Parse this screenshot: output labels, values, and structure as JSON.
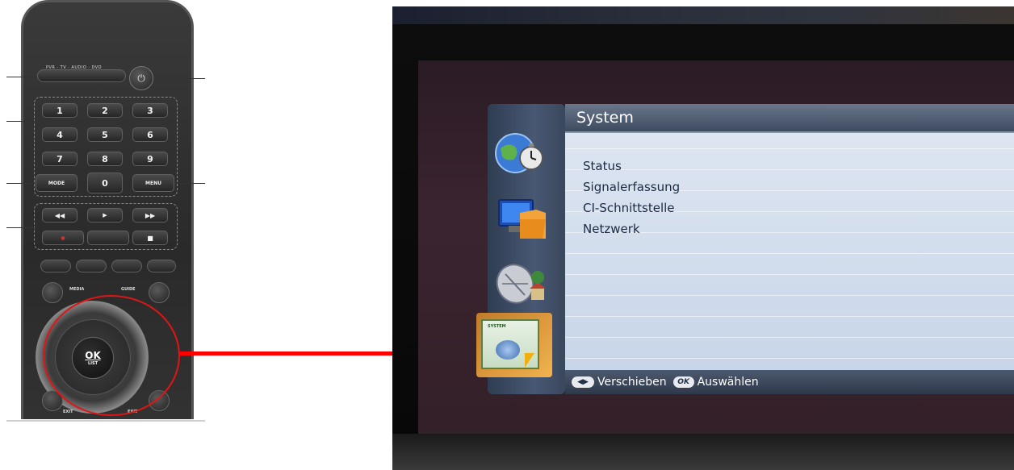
{
  "remote": {
    "top_labels": "PVR  ·  TV  ·  AUDIO  ·  DVD",
    "keys": [
      "1",
      "2",
      "3",
      "4",
      "5",
      "6",
      "7",
      "8",
      "9",
      "0"
    ],
    "mode_label": "MODE",
    "menu_label": "MENU",
    "ok_label": "OK",
    "ok_sub_label": "LIST",
    "vol_label": "MEDIA",
    "info_label": "GUIDE",
    "exit_label": "EXIT",
    "back_label": "EXIT"
  },
  "osd": {
    "title": "System",
    "menu_items": [
      "Status",
      "Signalerfassung",
      "CI-Schnittstelle",
      "Netzwerk"
    ],
    "footer": {
      "move_key": "◀▶",
      "move_label": "Verschieben",
      "ok_key": "OK",
      "ok_label": "Auswählen"
    },
    "selected_icon_tag": "SYSTEM"
  },
  "colors": {
    "highlight": "#ff0000",
    "panel_bg": "#dfe7f2",
    "header_bg": "#3d4a60"
  }
}
